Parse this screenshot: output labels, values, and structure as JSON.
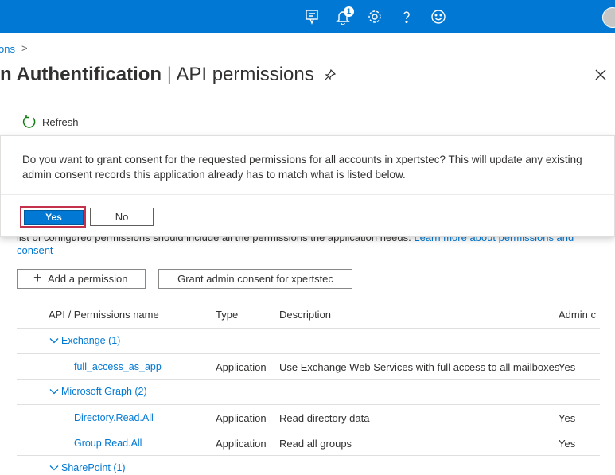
{
  "topbar": {
    "icons": [
      "feedback-icon",
      "notification-icon",
      "settings-icon",
      "help-icon",
      "smiley-icon"
    ],
    "notification_count": "1"
  },
  "breadcrumb": {
    "fragment": "ons",
    "separator": ">"
  },
  "header": {
    "title_bold": "n Authentification",
    "title_separator": "|",
    "title_rest": "API permissions"
  },
  "toolbar": {
    "refresh_label": "Refresh"
  },
  "dialog": {
    "message": "Do you want to grant consent for the requested permissions for all accounts in xpertstec? This will update any existing admin consent records this application already has to match what is listed below.",
    "yes_label": "Yes",
    "no_label": "No"
  },
  "intro": {
    "text_partial": "list of configured permissions should include all the permissions the application needs.",
    "link_partial": "Learn more about permissions and",
    "link_line2": "consent"
  },
  "actions": {
    "add_permission": "Add a permission",
    "grant_consent": "Grant admin consent for xpertstec"
  },
  "table": {
    "headers": {
      "name": "API / Permissions name",
      "type": "Type",
      "description": "Description",
      "admin": "Admin c"
    },
    "groups": [
      {
        "label": "Exchange (1)"
      },
      {
        "label": "Microsoft Graph (2)"
      },
      {
        "label": "SharePoint (1)"
      }
    ],
    "rows": [
      {
        "name": "full_access_as_app",
        "type": "Application",
        "description": "Use Exchange Web Services with full access to all mailboxes",
        "admin": "Yes"
      },
      {
        "name": "Directory.Read.All",
        "type": "Application",
        "description": "Read directory data",
        "admin": "Yes"
      },
      {
        "name": "Group.Read.All",
        "type": "Application",
        "description": "Read all groups",
        "admin": "Yes"
      }
    ]
  }
}
